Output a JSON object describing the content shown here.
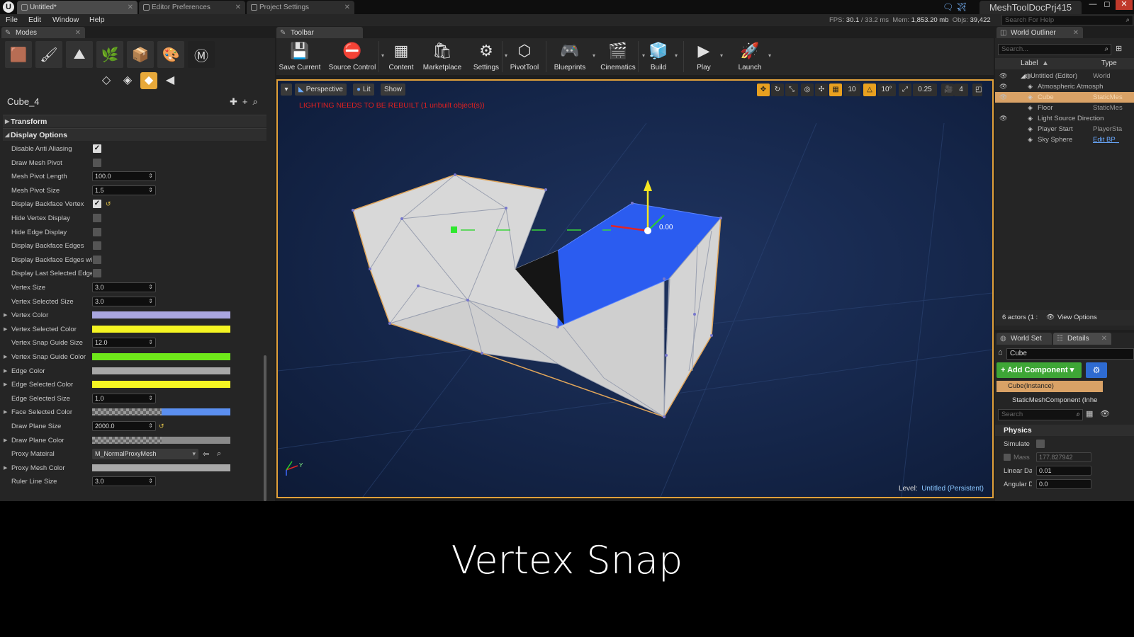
{
  "window": {
    "tabs": [
      "Untitled*",
      "Editor Preferences",
      "Project Settings"
    ],
    "project_name": "MeshToolDocPrj415"
  },
  "menu": [
    "File",
    "Edit",
    "Window",
    "Help"
  ],
  "stats": {
    "fps_label": "FPS:",
    "fps": "30.1",
    "ms": "/ 33.2 ms",
    "mem_label": "Mem:",
    "mem": "1,853.20 mb",
    "objs_label": "Objs:",
    "objs": "39,422"
  },
  "help_search": {
    "placeholder": "Search For Help"
  },
  "modes": {
    "tab_label": "Modes",
    "object_name": "Cube_4",
    "categories": {
      "transform": "Transform",
      "display_options": "Display Options"
    },
    "props": [
      {
        "label": "Disable Anti Aliasing",
        "kind": "check",
        "checked": true,
        "mark": "✓"
      },
      {
        "label": "Draw Mesh Pivot",
        "kind": "check",
        "checked": false
      },
      {
        "label": "Mesh Pivot Length",
        "kind": "num",
        "value": "100.0"
      },
      {
        "label": "Mesh Pivot Size",
        "kind": "num",
        "value": "1.5"
      },
      {
        "label": "Display Backface Vertex",
        "kind": "check",
        "checked": true,
        "mark": "✓"
      },
      {
        "label": "Hide Vertex Display",
        "kind": "check",
        "checked": false
      },
      {
        "label": "Hide Edge Display",
        "kind": "check",
        "checked": false
      },
      {
        "label": "Display Backface Edges",
        "kind": "check",
        "checked": false
      },
      {
        "label": "Display Backface Edges wi",
        "kind": "check",
        "checked": false
      },
      {
        "label": "Display Last Selected Edge",
        "kind": "check",
        "checked": false
      },
      {
        "label": "Vertex Size",
        "kind": "num",
        "value": "3.0"
      },
      {
        "label": "Vertex Selected Size",
        "kind": "num",
        "value": "3.0"
      },
      {
        "label": "Vertex Color",
        "kind": "color",
        "color": "#a9a6e0"
      },
      {
        "label": "Vertex Selected Color",
        "kind": "color",
        "color": "#f4f422"
      },
      {
        "label": "Vertex Snap Guide Size",
        "kind": "num",
        "value": "12.0"
      },
      {
        "label": "Vertex Snap Guide Color",
        "kind": "color",
        "color": "#6ee81a"
      },
      {
        "label": "Edge Color",
        "kind": "color",
        "color": "#a8a8a8"
      },
      {
        "label": "Edge Selected Color",
        "kind": "color",
        "color": "#f4f422"
      },
      {
        "label": "Edge Selected Size",
        "kind": "num",
        "value": "1.0"
      },
      {
        "label": "Face Selected Color",
        "kind": "color",
        "color": "#5b8ff0"
      },
      {
        "label": "Draw Plane Size",
        "kind": "num",
        "value": "2000.0"
      },
      {
        "label": "Draw Plane Color",
        "kind": "color",
        "color": "#8a8a8a"
      },
      {
        "label": "Proxy Mateiral",
        "kind": "dropdown",
        "value": "M_NormalProxyMesh"
      },
      {
        "label": "Proxy Mesh Color",
        "kind": "color",
        "color": "#a8a8a8"
      },
      {
        "label": "Ruler Line Size",
        "kind": "num",
        "value": "3.0"
      }
    ]
  },
  "toolbar": {
    "tab_label": "Toolbar",
    "items": [
      {
        "label": "Save Current",
        "icon": "💾"
      },
      {
        "label": "Source Control",
        "icon": "⛔"
      },
      {
        "label": "Content",
        "icon": "▦"
      },
      {
        "label": "Marketplace",
        "icon": "🛍"
      },
      {
        "label": "Settings",
        "icon": "⚙"
      },
      {
        "label": "PivotTool",
        "icon": "⬡"
      },
      {
        "label": "Blueprints",
        "icon": "🎮"
      },
      {
        "label": "Cinematics",
        "icon": "🎬"
      },
      {
        "label": "Build",
        "icon": "🧊"
      },
      {
        "label": "Play",
        "icon": "▶"
      },
      {
        "label": "Launch",
        "icon": "🚀"
      }
    ]
  },
  "viewport": {
    "perspective": "Perspective",
    "lit": "Lit",
    "show": "Show",
    "warning": "LIGHTING NEEDS TO BE REBUILT (1 unbuilt object(s))",
    "grid_snap": "10",
    "rot_snap": "10°",
    "scale_snap": "0.25",
    "cam_speed": "4",
    "gizmo_value": "0.00",
    "level_label": "Level:",
    "level_name": "Untitled (Persistent)",
    "axis_y": "Y"
  },
  "outliner": {
    "tab_label": "World Outliner",
    "search_placeholder": "Search...",
    "col_label": "Label",
    "col_type": "Type",
    "rows": [
      {
        "name": "Untitled (Editor)",
        "type": "World"
      },
      {
        "name": "Atmospheric Atmosph",
        "type": ""
      },
      {
        "name": "Cube",
        "type": "StaticMes"
      },
      {
        "name": "Floor",
        "type": "StaticMes"
      },
      {
        "name": "Light Source Direction",
        "type": ""
      },
      {
        "name": "Player Start",
        "type": "PlayerSta"
      },
      {
        "name": "Sky Sphere",
        "type": "Edit BP_"
      }
    ],
    "actors": "6 actors (1 :",
    "view_options": "View Options"
  },
  "details": {
    "tab_world": "World Set",
    "tab_details": "Details",
    "name_value": "Cube",
    "add_component": "+ Add Component",
    "instance": "Cube(Instance)",
    "component": "StaticMeshComponent (Inhe",
    "search_placeholder": "Search",
    "physics": "Physics",
    "simulate": "Simulate",
    "mass_label": "Mass",
    "mass": "177.827942",
    "linear_label": "Linear Da",
    "linear": "0.01",
    "angular_label": "Angular D",
    "angular": "0.0"
  },
  "caption": "Vertex Snap"
}
